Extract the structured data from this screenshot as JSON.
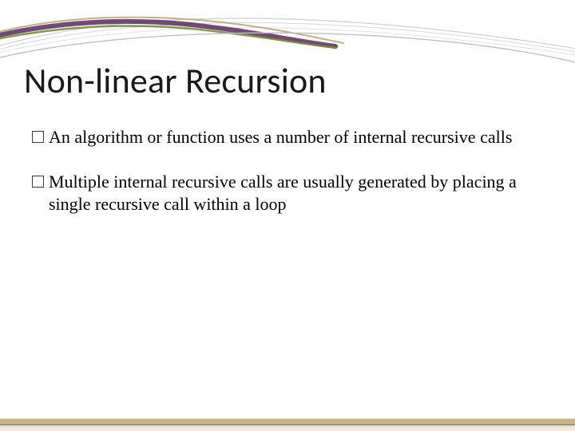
{
  "title": "Non-linear Recursion",
  "bullets": [
    "An algorithm or function uses a number of internal recursive calls",
    "Multiple internal recursive calls are usually generated by placing a single recursive call within a loop"
  ],
  "theme": {
    "curve_purple": "#5a2a5a",
    "curve_olive": "#7a8a3a",
    "curve_tan": "#b8a878",
    "curve_grey": "#bfbfbf",
    "footer_tint": "#c7b58e"
  }
}
